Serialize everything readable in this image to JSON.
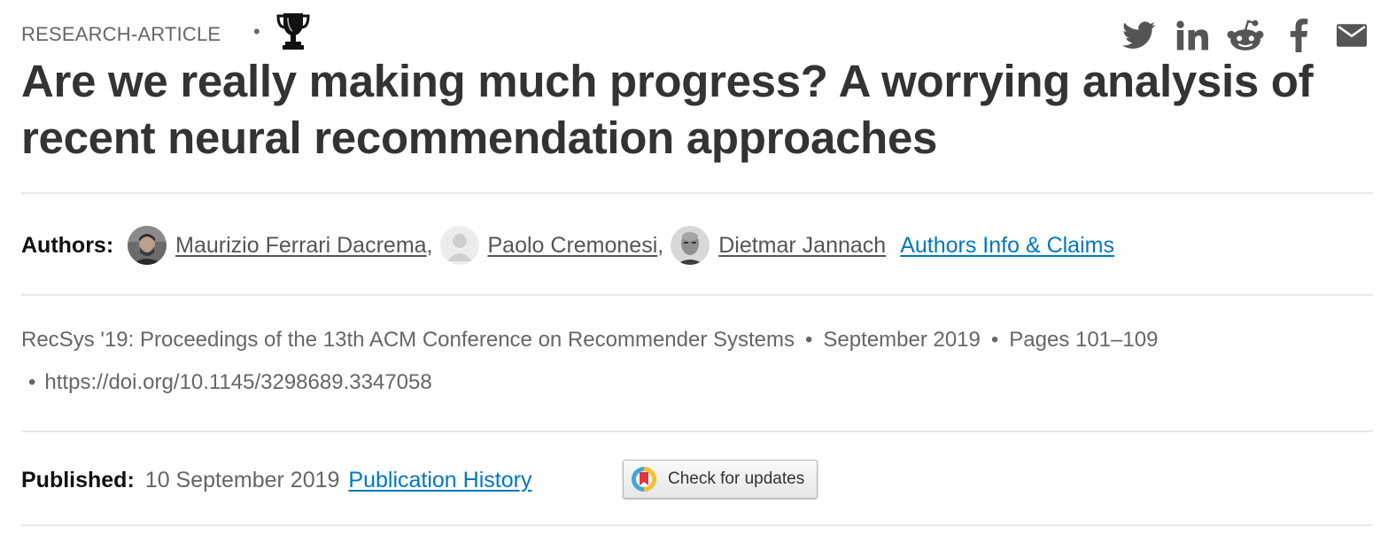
{
  "header": {
    "article_type": "RESEARCH-ARTICLE",
    "separator": "•",
    "award_icon": "trophy-icon",
    "share_icons": [
      "twitter-icon",
      "linkedin-icon",
      "reddit-icon",
      "facebook-icon",
      "email-icon"
    ]
  },
  "title": "Are we really making much progress? A worrying analysis of recent neural recommendation approaches",
  "authors": {
    "label": "Authors:",
    "list": [
      {
        "name": "Maurizio Ferrari Dacrema",
        "separator": ","
      },
      {
        "name": "Paolo Cremonesi",
        "separator": ","
      },
      {
        "name": "Dietmar Jannach",
        "separator": ""
      }
    ],
    "info_link": "Authors Info & Claims"
  },
  "proceedings": {
    "venue": "RecSys '19: Proceedings of the 13th ACM Conference on Recommender Systems",
    "date": "September 2019",
    "pages": "Pages 101–109",
    "bullet": "•",
    "doi": "https://doi.org/10.1145/3298689.3347058"
  },
  "published": {
    "label": "Published:",
    "date": "10 September 2019",
    "history_link": "Publication History"
  },
  "check_updates": {
    "label": "Check for updates"
  },
  "colors": {
    "text": "#333333",
    "muted": "#666666",
    "link": "#0077c2",
    "divider": "#e8e8e8"
  }
}
